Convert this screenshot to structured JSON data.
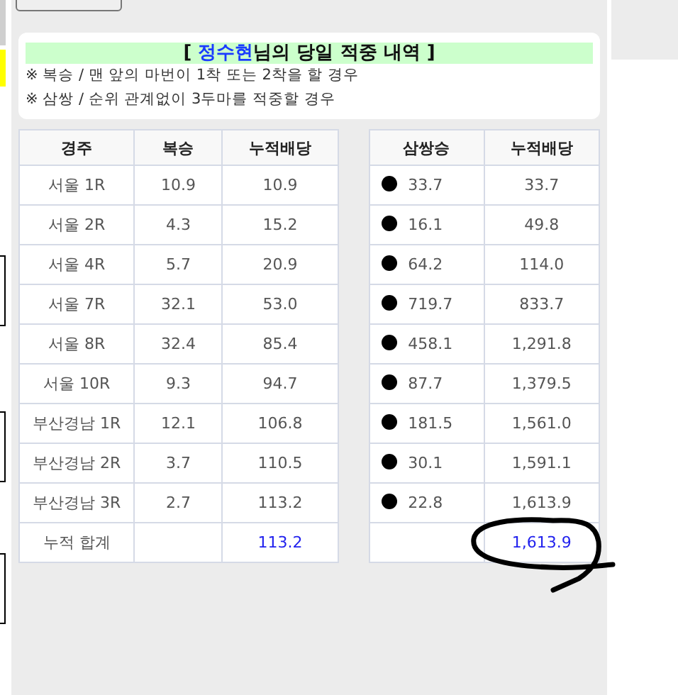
{
  "title": {
    "open": "[",
    "name": "정수현",
    "suffix": "님의 당일 적중 내역",
    "close": "]"
  },
  "notes": [
    "※ 복승 / 맨 앞의 마번이 1착 또는 2착을 할 경우",
    "※ 삼쌍 / 순위 관계없이 3두마를 적중할 경우"
  ],
  "left_table": {
    "columns": [
      "경주",
      "복승",
      "누적배당"
    ],
    "rows": [
      [
        "서울 1R",
        "10.9",
        "10.9"
      ],
      [
        "서울 2R",
        "4.3",
        "15.2"
      ],
      [
        "서울 4R",
        "5.7",
        "20.9"
      ],
      [
        "서울 7R",
        "32.1",
        "53.0"
      ],
      [
        "서울 8R",
        "32.4",
        "85.4"
      ],
      [
        "서울 10R",
        "9.3",
        "94.7"
      ],
      [
        "부산경남 1R",
        "12.1",
        "106.8"
      ],
      [
        "부산경남 2R",
        "3.7",
        "110.5"
      ],
      [
        "부산경남 3R",
        "2.7",
        "113.2"
      ]
    ],
    "total": {
      "label": "누적 합계",
      "value": "113.2"
    }
  },
  "right_table": {
    "columns": [
      "삼쌍승",
      "누적배당"
    ],
    "rows": [
      [
        "33.7",
        "33.7"
      ],
      [
        "16.1",
        "49.8"
      ],
      [
        "64.2",
        "114.0"
      ],
      [
        "719.7",
        "833.7"
      ],
      [
        "458.1",
        "1,291.8"
      ],
      [
        "87.7",
        "1,379.5"
      ],
      [
        "181.5",
        "1,561.0"
      ],
      [
        "30.1",
        "1,591.1"
      ],
      [
        "22.8",
        "1,613.9"
      ]
    ],
    "total": {
      "value": "1,613.9"
    }
  }
}
